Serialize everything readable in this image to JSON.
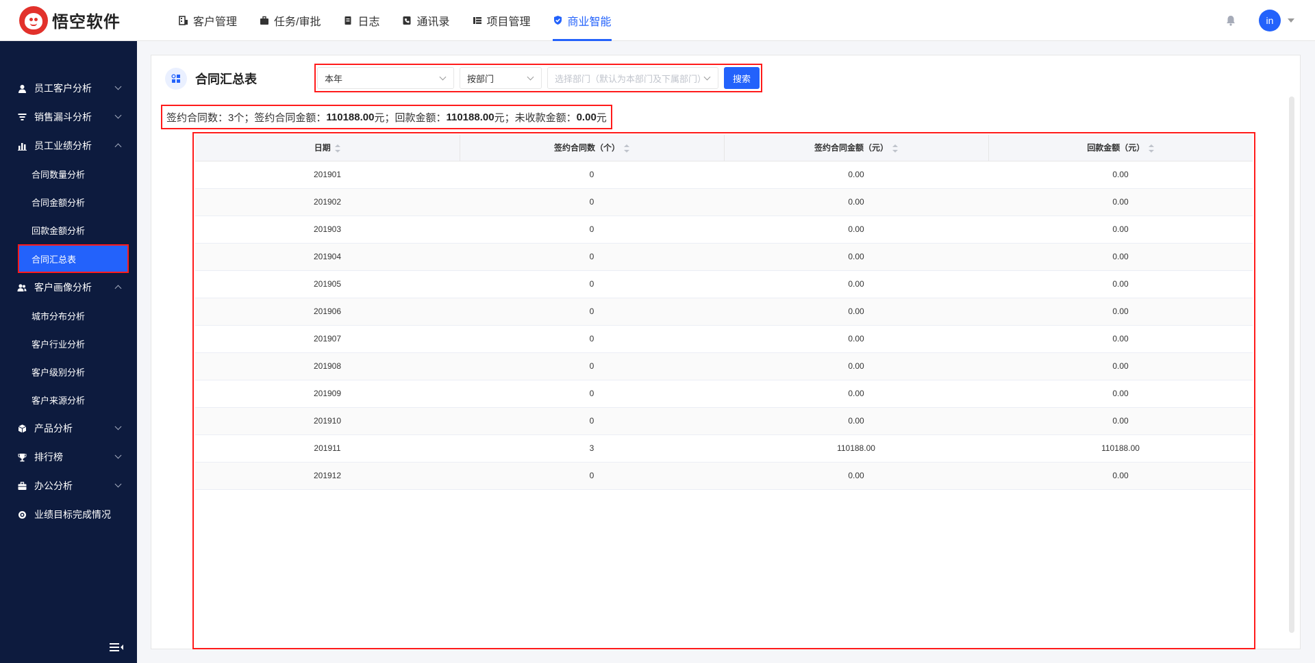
{
  "app": {
    "logo_text": "悟空软件"
  },
  "topnav": [
    {
      "label": "客户管理",
      "icon": "building-icon"
    },
    {
      "label": "任务/审批",
      "icon": "briefcase-icon"
    },
    {
      "label": "日志",
      "icon": "notebook-icon"
    },
    {
      "label": "通讯录",
      "icon": "phone-book-icon"
    },
    {
      "label": "项目管理",
      "icon": "list-icon"
    },
    {
      "label": "商业智能",
      "icon": "shield-check-icon",
      "active": true
    }
  ],
  "user": {
    "avatar_text": "in"
  },
  "sidebar": {
    "groups": [
      {
        "label": "员工客户分析",
        "icon": "person-icon",
        "expanded": false
      },
      {
        "label": "销售漏斗分析",
        "icon": "funnel-icon",
        "expanded": false
      },
      {
        "label": "员工业绩分析",
        "icon": "bar-chart-icon",
        "expanded": true,
        "items": [
          "合同数量分析",
          "合同金额分析",
          "回款金额分析",
          "合同汇总表"
        ],
        "active_item": "合同汇总表"
      },
      {
        "label": "客户画像分析",
        "icon": "people-icon",
        "expanded": true,
        "items": [
          "城市分布分析",
          "客户行业分析",
          "客户级别分析",
          "客户来源分析"
        ]
      },
      {
        "label": "产品分析",
        "icon": "cube-icon",
        "expanded": false
      },
      {
        "label": "排行榜",
        "icon": "trophy-icon",
        "expanded": false
      },
      {
        "label": "办公分析",
        "icon": "briefcase-icon",
        "expanded": false
      },
      {
        "label": "业绩目标完成情况",
        "icon": "target-icon",
        "expanded": false,
        "no_arrow": true
      }
    ]
  },
  "panel": {
    "title": "合同汇总表",
    "filters": {
      "period": "本年",
      "type": "按部门",
      "dept_placeholder": "选择部门（默认为本部门及下属部门）",
      "search_label": "搜索"
    },
    "summary": {
      "contract_count_label": "签约合同数：",
      "contract_count": "3个",
      "contract_amount_label": "；签约合同金额：",
      "contract_amount": "110188.00",
      "unit": "元",
      "received_label": "；回款金额：",
      "received_amount": "110188.00",
      "unreceived_label": "；未收款金额：",
      "unreceived_amount": "0.00"
    },
    "table": {
      "columns": [
        "日期",
        "签约合同数（个）",
        "签约合同金额（元）",
        "回款金额（元）"
      ],
      "rows": [
        [
          "201901",
          "0",
          "0.00",
          "0.00"
        ],
        [
          "201902",
          "0",
          "0.00",
          "0.00"
        ],
        [
          "201903",
          "0",
          "0.00",
          "0.00"
        ],
        [
          "201904",
          "0",
          "0.00",
          "0.00"
        ],
        [
          "201905",
          "0",
          "0.00",
          "0.00"
        ],
        [
          "201906",
          "0",
          "0.00",
          "0.00"
        ],
        [
          "201907",
          "0",
          "0.00",
          "0.00"
        ],
        [
          "201908",
          "0",
          "0.00",
          "0.00"
        ],
        [
          "201909",
          "0",
          "0.00",
          "0.00"
        ],
        [
          "201910",
          "0",
          "0.00",
          "0.00"
        ],
        [
          "201911",
          "3",
          "110188.00",
          "110188.00"
        ],
        [
          "201912",
          "0",
          "0.00",
          "0.00"
        ]
      ]
    }
  },
  "colors": {
    "primary": "#2362fb",
    "sidebar_bg": "#0d1b3e",
    "highlight": "#ff1a1a"
  }
}
